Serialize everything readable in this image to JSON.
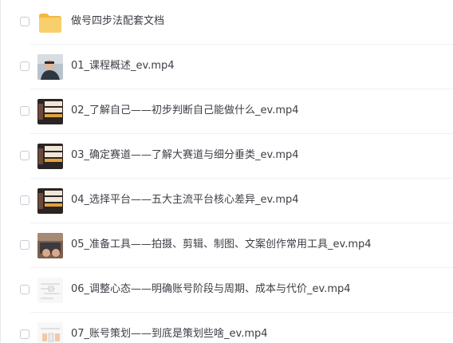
{
  "files": [
    {
      "name": "做号四步法配套文档",
      "icon": "folder-icon"
    },
    {
      "name": "01_课程概述_ev.mp4",
      "icon": "video-thumbnail-person"
    },
    {
      "name": "02_了解自己——初步判断自己能做什么_ev.mp4",
      "icon": "video-thumbnail-cover"
    },
    {
      "name": "03_确定赛道——了解大赛道与细分垂类_ev.mp4",
      "icon": "video-thumbnail-cover"
    },
    {
      "name": "04_选择平台——五大主流平台核心差异_ev.mp4",
      "icon": "video-thumbnail-cover"
    },
    {
      "name": "05_准备工具——拍摄、剪辑、制图、文案创作常用工具_ev.mp4",
      "icon": "video-thumbnail-hands"
    },
    {
      "name": "06_调整心态——明确账号阶段与周期、成本与代价_ev.mp4",
      "icon": "video-thumbnail-diagram"
    },
    {
      "name": "07_账号策划——到底是策划些啥_ev.mp4",
      "icon": "video-thumbnail-diagram"
    }
  ],
  "colors": {
    "folder": "#f6c95c",
    "text": "#3c3f45",
    "separator": "#eef0f3",
    "checkbox_border": "#c9ccd3"
  }
}
